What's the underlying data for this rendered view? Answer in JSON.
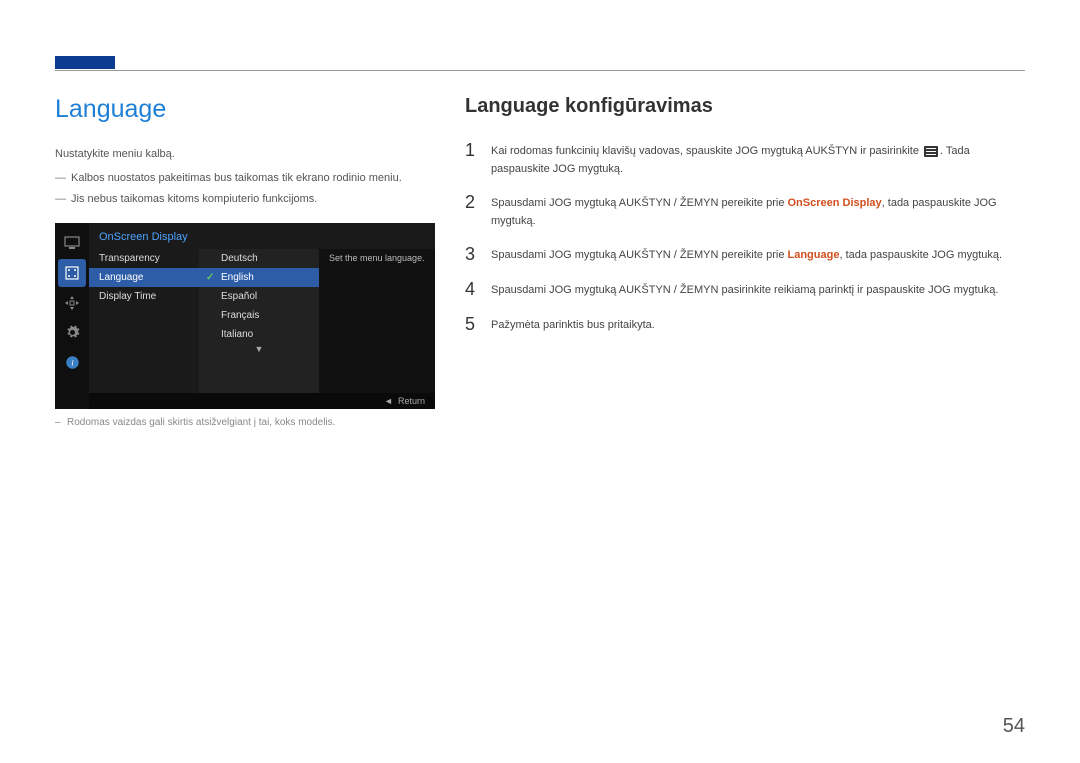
{
  "page_number": "54",
  "left": {
    "heading": "Language",
    "intro": "Nustatykite meniu kalbą.",
    "bullets": [
      "Kalbos nuostatos pakeitimas bus taikomas tik ekrano rodinio meniu.",
      "Jis nebus taikomas kitoms kompiuterio funkcijoms."
    ],
    "caption": "Rodomas vaizdas gali skirtis atsižvelgiant į tai, koks modelis."
  },
  "osd": {
    "title": "OnScreen Display",
    "items": [
      "Transparency",
      "Language",
      "Display Time"
    ],
    "selected_item": "Language",
    "languages": [
      "Deutsch",
      "English",
      "Español",
      "Français",
      "Italiano"
    ],
    "selected_language": "English",
    "description": "Set the menu language.",
    "return_label": "Return"
  },
  "right": {
    "heading": "Language konfigūravimas",
    "steps": [
      {
        "n": "1",
        "pre": "Kai rodomas funkcinių klavišų vadovas, spauskite JOG mygtuką AUKŠTYN ir pasirinkite ",
        "post": ". Tada paspauskite JOG mygtuką."
      },
      {
        "n": "2",
        "pre": "Spausdami JOG mygtuką AUKŠTYN / ŽEMYN pereikite prie ",
        "orange": "OnScreen Display",
        "post": ", tada paspauskite JOG mygtuką."
      },
      {
        "n": "3",
        "pre": "Spausdami JOG mygtuką AUKŠTYN / ŽEMYN pereikite prie ",
        "orange": "Language",
        "post": ", tada paspauskite JOG mygtuką."
      },
      {
        "n": "4",
        "pre": "Spausdami JOG mygtuką AUKŠTYN / ŽEMYN pasirinkite reikiamą parinktį ir paspauskite JOG mygtuką."
      },
      {
        "n": "5",
        "pre": "Pažymėta parinktis bus pritaikyta."
      }
    ]
  }
}
